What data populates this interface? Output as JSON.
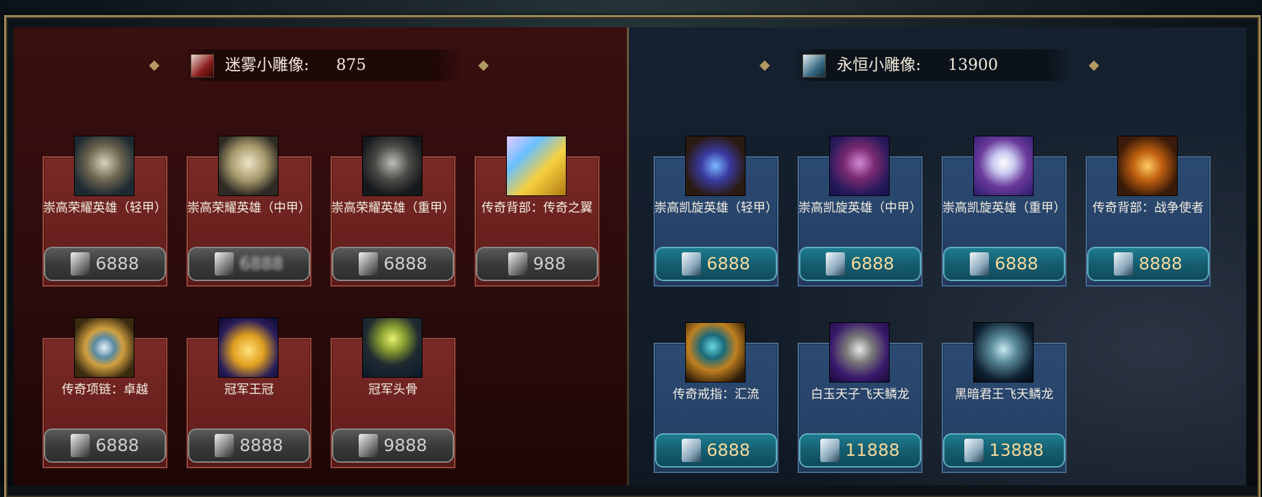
{
  "left_shop": {
    "currency_label": "迷雾小雕像:",
    "currency_value": "875",
    "currency_icon": "mist-figurine-icon",
    "items": [
      {
        "name": "崇高荣耀英雄（轻甲）",
        "price": "6888"
      },
      {
        "name": "崇高荣耀英雄（中甲）",
        "price": "6888"
      },
      {
        "name": "崇高荣耀英雄（重甲）",
        "price": "6888"
      },
      {
        "name": "传奇背部：传奇之翼",
        "price": "988"
      },
      {
        "name": "传奇项链：卓越",
        "price": "6888"
      },
      {
        "name": "冠军王冠",
        "price": "8888"
      },
      {
        "name": "冠军头骨",
        "price": "9888"
      }
    ]
  },
  "right_shop": {
    "currency_label": "永恒小雕像:",
    "currency_value": "13900",
    "currency_icon": "eternal-figurine-icon",
    "items": [
      {
        "name": "崇高凯旋英雄（轻甲）",
        "price": "6888"
      },
      {
        "name": "崇高凯旋英雄（中甲）",
        "price": "6888"
      },
      {
        "name": "崇高凯旋英雄（重甲）",
        "price": "6888"
      },
      {
        "name": "传奇背部：战争使者",
        "price": "8888"
      },
      {
        "name": "传奇戒指：汇流",
        "price": "6888"
      },
      {
        "name": "白玉天子飞天鳞龙",
        "price": "11888"
      },
      {
        "name": "黑暗君王飞天鳞龙",
        "price": "13888"
      }
    ]
  },
  "colors": {
    "left_panel": "#3a0f0f",
    "right_panel": "#152130",
    "gold_trim": "#9d8758",
    "blue_price_text": "#f4d79a"
  }
}
